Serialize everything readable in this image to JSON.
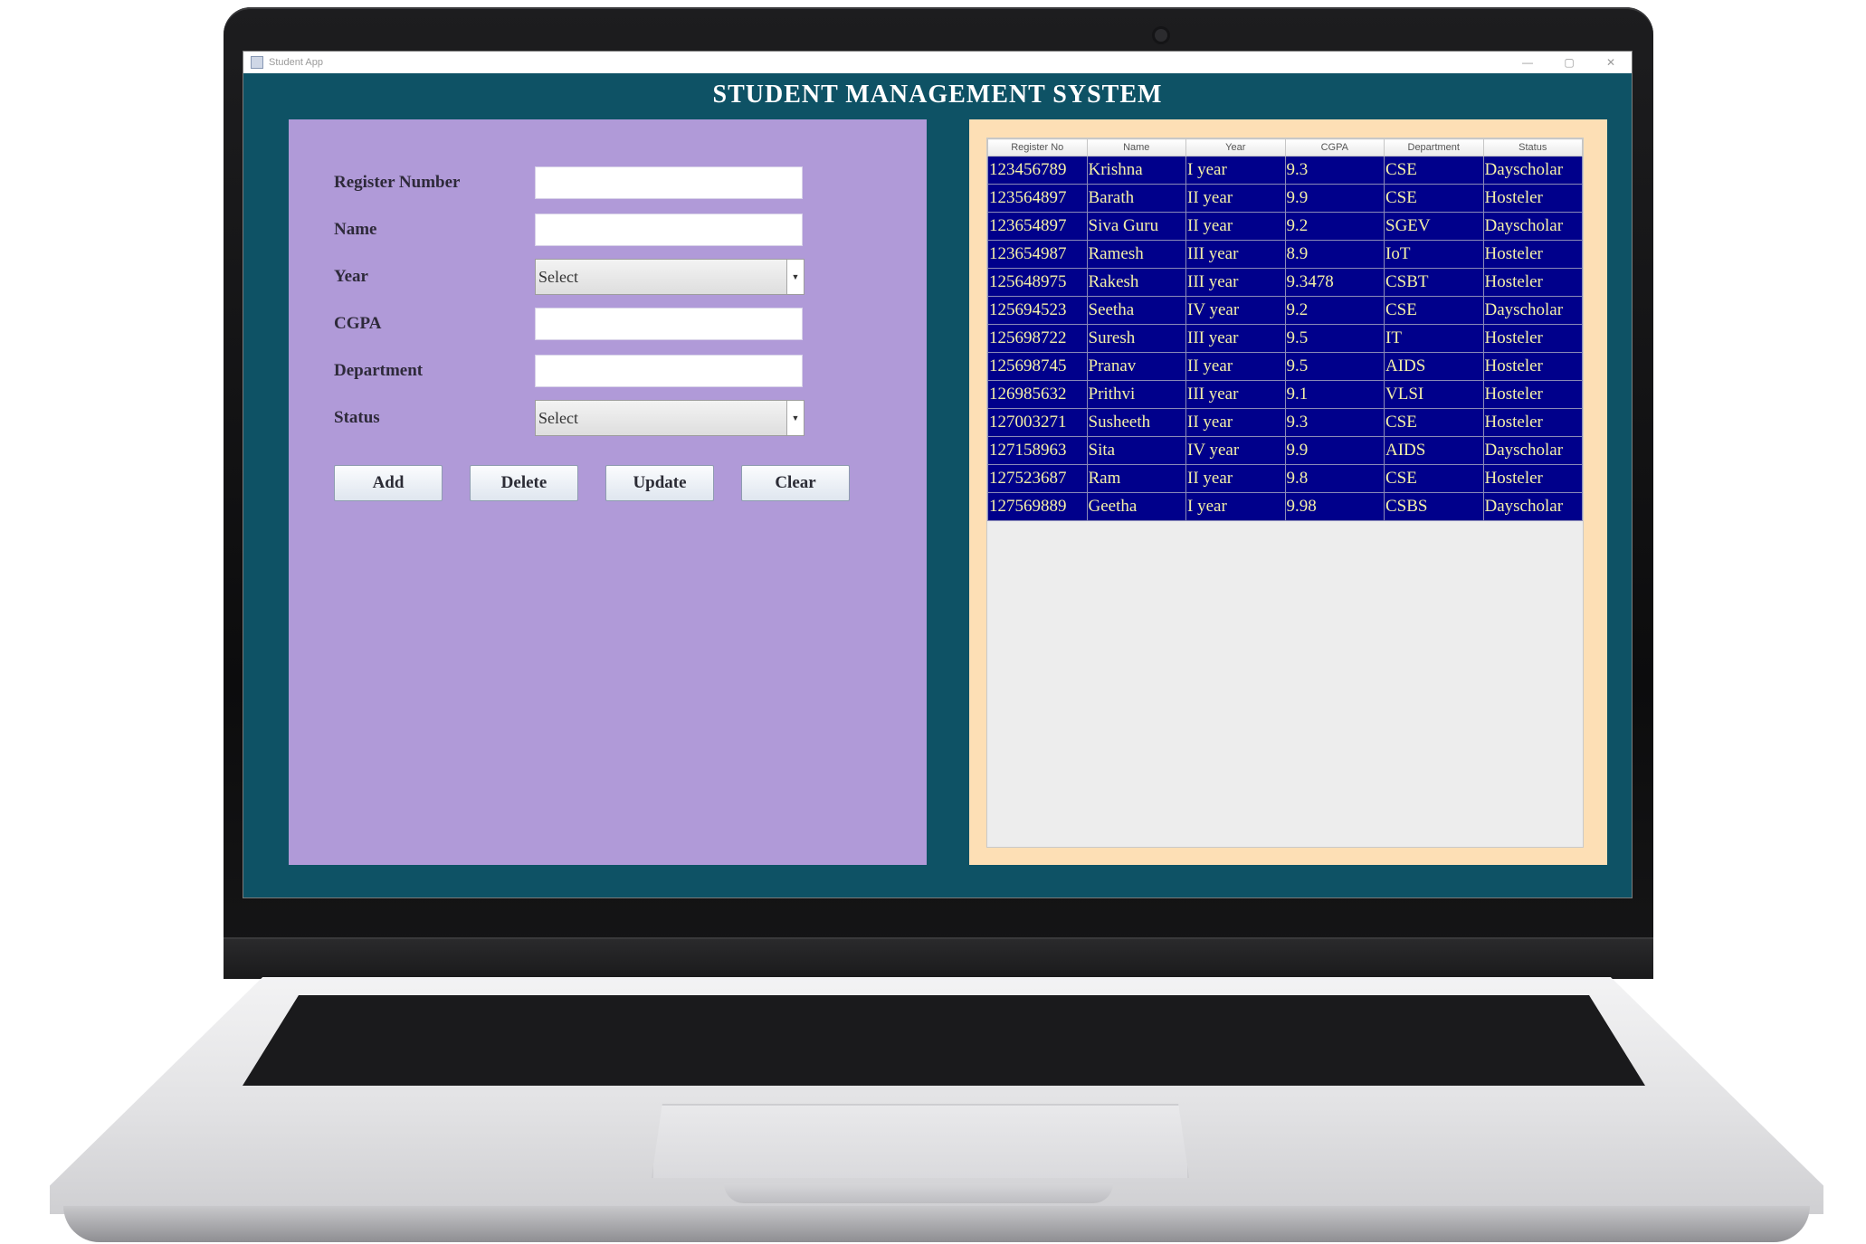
{
  "window": {
    "title": "Student App",
    "controls": [
      "—",
      "▢",
      "✕"
    ]
  },
  "app_title": "STUDENT MANAGEMENT SYSTEM",
  "form": {
    "fields": [
      {
        "label": "Register Number",
        "type": "text",
        "value": ""
      },
      {
        "label": "Name",
        "type": "text",
        "value": ""
      },
      {
        "label": "Year",
        "type": "select",
        "value": "Select"
      },
      {
        "label": "CGPA",
        "type": "text",
        "value": ""
      },
      {
        "label": "Department",
        "type": "text",
        "value": ""
      },
      {
        "label": "Status",
        "type": "select",
        "value": "Select"
      }
    ],
    "buttons": {
      "add": "Add",
      "delete": "Delete",
      "update": "Update",
      "clear": "Clear"
    }
  },
  "table": {
    "columns": [
      "Register No",
      "Name",
      "Year",
      "CGPA",
      "Department",
      "Status"
    ],
    "rows": [
      [
        "123456789",
        "Krishna",
        "I year",
        "9.3",
        "CSE",
        "Dayscholar"
      ],
      [
        "123564897",
        "Barath",
        "II year",
        "9.9",
        "CSE",
        "Hosteler"
      ],
      [
        "123654897",
        "Siva Guru",
        "II year",
        "9.2",
        "SGEV",
        "Dayscholar"
      ],
      [
        "123654987",
        "Ramesh",
        "III year",
        "8.9",
        "IoT",
        "Hosteler"
      ],
      [
        "125648975",
        "Rakesh",
        "III year",
        "9.3478",
        "CSBT",
        "Hosteler"
      ],
      [
        "125694523",
        "Seetha",
        "IV year",
        "9.2",
        "CSE",
        "Dayscholar"
      ],
      [
        "125698722",
        "Suresh",
        "III year",
        "9.5",
        "IT",
        "Hosteler"
      ],
      [
        "125698745",
        "Pranav",
        "II year",
        "9.5",
        "AIDS",
        "Hosteler"
      ],
      [
        "126985632",
        "Prithvi",
        "III year",
        "9.1",
        "VLSI",
        "Hosteler"
      ],
      [
        "127003271",
        "Susheeth",
        "II year",
        "9.3",
        "CSE",
        "Hosteler"
      ],
      [
        "127158963",
        "Sita",
        "IV year",
        "9.9",
        "AIDS",
        "Dayscholar"
      ],
      [
        "127523687",
        "Ram",
        "II year",
        "9.8",
        "CSE",
        "Hosteler"
      ],
      [
        "127569889",
        "Geetha",
        "I year",
        "9.98",
        "CSBS",
        "Dayscholar"
      ]
    ]
  },
  "colors": {
    "window_bg": "#0e5265",
    "form_panel": "#b09ad8",
    "table_panel": "#fddfb5",
    "row_bg": "#00008b",
    "row_text": "#f4f0a8"
  }
}
